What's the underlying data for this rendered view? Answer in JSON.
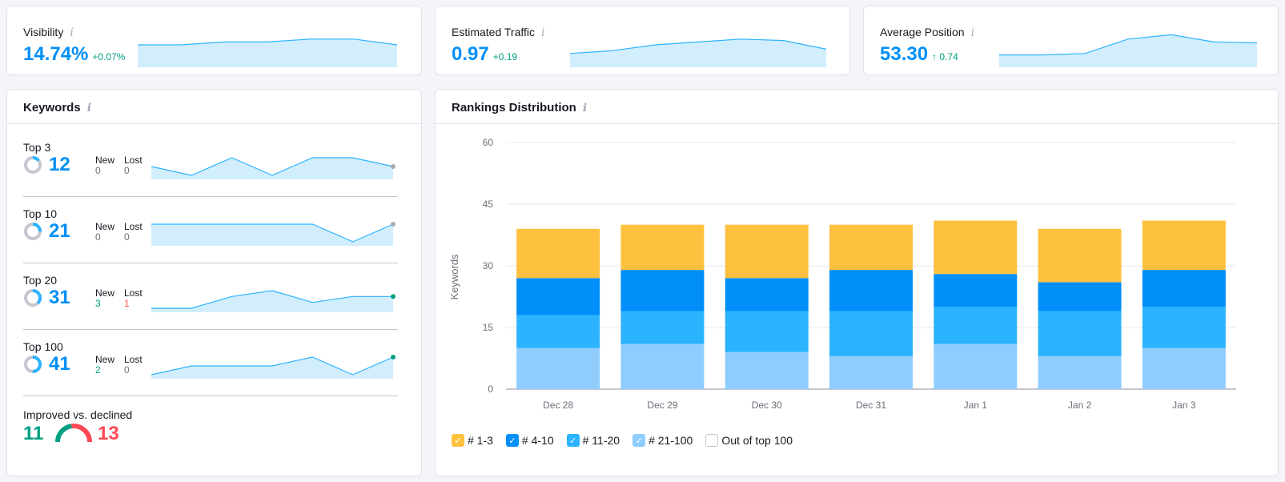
{
  "metrics": [
    {
      "title": "Visibility",
      "value": "14.74%",
      "delta": "+0.07%",
      "spark": [
        5,
        5,
        6,
        6,
        7,
        7,
        5
      ]
    },
    {
      "title": "Estimated Traffic",
      "value": "0.97",
      "delta": "+0.19",
      "spark": [
        2,
        3,
        5,
        6,
        7,
        6.5,
        3.5
      ]
    },
    {
      "title": "Average Position",
      "value": "53.30",
      "delta": "↑ 0.74",
      "spark": [
        1.5,
        1.5,
        2,
        7,
        8.5,
        6,
        5.7
      ]
    }
  ],
  "keywords": {
    "title": "Keywords",
    "new_label": "New",
    "lost_label": "Lost",
    "rows": [
      {
        "label": "Top 3",
        "count": "12",
        "share": 0.29,
        "new": "0",
        "lost": "0",
        "new_class": "",
        "lost_class": "",
        "spark": [
          12,
          11,
          13,
          11,
          13,
          13,
          12
        ],
        "dot_color": "#a8aab5"
      },
      {
        "label": "Top 10",
        "count": "21",
        "share": 0.51,
        "new": "0",
        "lost": "0",
        "new_class": "",
        "lost_class": "",
        "spark": [
          21,
          21,
          21,
          21,
          21,
          20,
          21
        ],
        "dot_color": "#a8aab5"
      },
      {
        "label": "Top 20",
        "count": "31",
        "share": 0.76,
        "new": "3",
        "lost": "1",
        "new_class": "pos",
        "lost_class": "neg",
        "spark": [
          29,
          29,
          31,
          32,
          30,
          31,
          31
        ],
        "dot_color": "#009f81"
      },
      {
        "label": "Top 100",
        "count": "41",
        "share": 1.0,
        "new": "2",
        "lost": "0",
        "new_class": "pos",
        "lost_class": "",
        "spark": [
          39,
          40,
          40,
          40,
          41,
          39,
          41
        ],
        "dot_color": "#009f81"
      }
    ],
    "improved_label": "Improved vs. declined",
    "improved": "11",
    "declined": "13"
  },
  "rankings": {
    "title": "Rankings Distribution",
    "legend": [
      {
        "label": "# 1-3",
        "color": "#fdc13f",
        "checked": true
      },
      {
        "label": "# 4-10",
        "color": "#008ff8",
        "checked": true
      },
      {
        "label": "# 11-20",
        "color": "#2bb3ff",
        "checked": true
      },
      {
        "label": "# 21-100",
        "color": "#8fcdff",
        "checked": true
      },
      {
        "label": "Out of top 100",
        "color": "#ffffff",
        "checked": false
      }
    ]
  },
  "chart_data": {
    "type": "bar",
    "stacked": true,
    "title": "Rankings Distribution",
    "xlabel": "",
    "ylabel": "Keywords",
    "ylim": [
      0,
      60
    ],
    "yticks": [
      0,
      15,
      30,
      45,
      60
    ],
    "grid": true,
    "legend_position": "bottom-left",
    "categories": [
      "Dec 28",
      "Dec 29",
      "Dec 30",
      "Dec 31",
      "Jan 1",
      "Jan 2",
      "Jan 3"
    ],
    "series": [
      {
        "name": "# 21-100",
        "color": "#8fcdff",
        "values": [
          10,
          11,
          9,
          8,
          11,
          8,
          10
        ]
      },
      {
        "name": "# 11-20",
        "color": "#2bb3ff",
        "values": [
          8,
          8,
          10,
          11,
          9,
          11,
          10
        ]
      },
      {
        "name": "# 4-10",
        "color": "#008ff8",
        "values": [
          9,
          10,
          8,
          10,
          8,
          7,
          9
        ]
      },
      {
        "name": "# 1-3",
        "color": "#fdc13f",
        "values": [
          12,
          11,
          13,
          11,
          13,
          13,
          12
        ]
      }
    ]
  }
}
